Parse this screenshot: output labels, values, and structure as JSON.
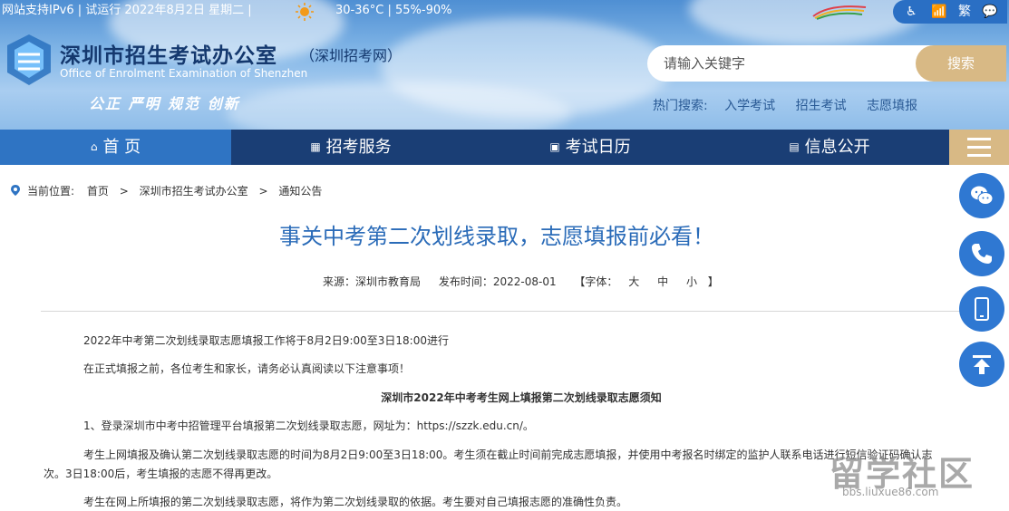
{
  "topbar": {
    "info": "网站支持IPv6 | 试运行   2022年8月2日 星期二 |",
    "weather": "30-36°C | 55%-90%",
    "accessibility": [
      "♿",
      "📶",
      "繁",
      "💬"
    ]
  },
  "header": {
    "title": "深圳市招生考试办公室",
    "subtitle": "（深圳招考网）",
    "title_en": "Office of Enrolment Examination of Shenzhen",
    "slogan": "公正  严明  规范  创新"
  },
  "search": {
    "placeholder": "请输入关键字",
    "button_label": "搜索",
    "hot_label": "热门搜索:",
    "hot_links": [
      "入学考试",
      "招生考试",
      "志愿填报"
    ]
  },
  "nav": {
    "items": [
      {
        "label": "首 页",
        "icon": "home-icon"
      },
      {
        "label": "招考服务",
        "icon": "grid-icon"
      },
      {
        "label": "考试日历",
        "icon": "calendar-icon"
      },
      {
        "label": "信息公开",
        "icon": "info-icon"
      }
    ],
    "menu_icon": "hamburger-icon"
  },
  "breadcrumb": {
    "label": "当前位置:",
    "items": [
      "首页",
      "深圳市招生考试办公室",
      "通知公告"
    ]
  },
  "article": {
    "title": "事关中考第二次划线录取，志愿填报前必看！",
    "source": "来源：深圳市教育局",
    "date": "发布时间：2022-08-01",
    "font_size_label": "【字体：",
    "font_sizes": [
      "大",
      "中",
      "小"
    ],
    "font_size_end": "】",
    "paragraphs": [
      "2022年中考第二次划线录取志愿填报工作将于8月2日9:00至3日18:00进行",
      "在正式填报之前，各位考生和家长，请务必认真阅读以下注意事项！",
      "深圳市2022年中考考生网上填报第二次划线录取志愿须知",
      "1、登录深圳市中考中招管理平台填报第二次划线录取志愿，网址为：https://szzk.edu.cn/。",
      "考生上网填报及确认第二次划线录取志愿的时间为8月2日9:00至3日18:00。考生须在截止时间前完成志愿填报，并使用中考报名时绑定的监护人联系电话进行短信验证码确认志",
      "次。3日18:00后，考生填报的志愿不得再更改。",
      "考生在网上所填报的第二次划线录取志愿，将作为第二次划线录取的依据。考生要对自己填报志愿的准确性负责。"
    ]
  },
  "floating": [
    "wechat-icon",
    "phone-icon",
    "mobile-icon",
    "back-to-top-icon"
  ],
  "watermark": {
    "text": "留学社区",
    "url": "bbs.liuxue86.com"
  },
  "colors": {
    "nav_blue": "#2f74c3",
    "nav_dark": "#1a3e75",
    "accent_gold": "#d8b985",
    "title_blue": "#2a6bb8"
  }
}
